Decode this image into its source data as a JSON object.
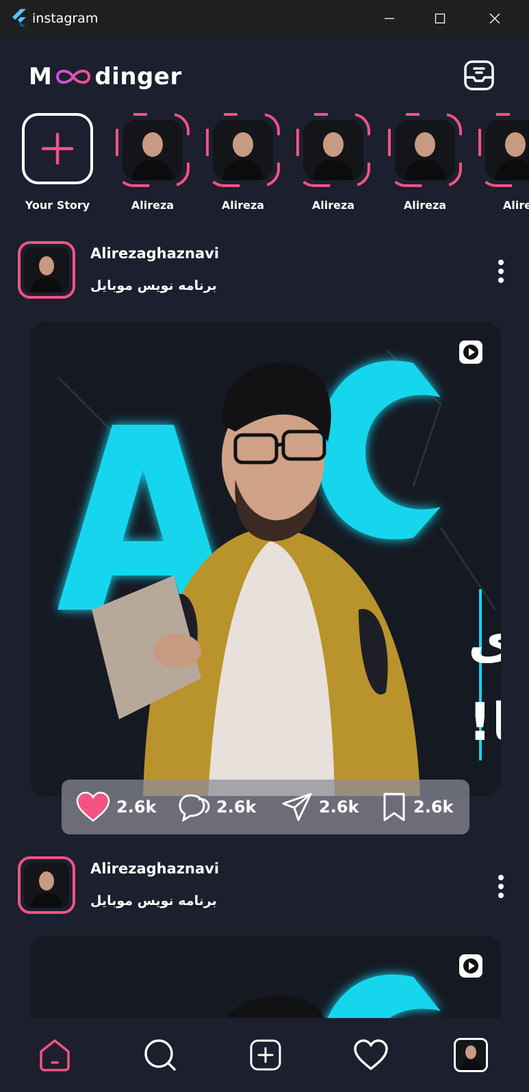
{
  "window": {
    "title": "instagram"
  },
  "brand": {
    "logo_pre": "M",
    "logo_post": "dinger"
  },
  "stories": {
    "your_story_label": "Your Story",
    "items": [
      {
        "label": "Alireza"
      },
      {
        "label": "Alireza"
      },
      {
        "label": "Alireza"
      },
      {
        "label": "Alireza"
      },
      {
        "label": "Alire"
      }
    ]
  },
  "posts": [
    {
      "username": "Alirezaghaznavi",
      "bio": "برنامه نویس موبایل",
      "image_text_line1": "انگلیسی برای",
      "image_text_line2": "برنامه نویس ها!",
      "likes": "2.6k",
      "comments": "2.6k",
      "shares": "2.6k",
      "saves": "2.6k"
    },
    {
      "username": "Alirezaghaznavi",
      "bio": "برنامه نویس موبایل"
    }
  ],
  "colors": {
    "accent": "#f35383",
    "bg": "#1c1f2e",
    "cyan": "#19d8f0"
  },
  "icons": {
    "nav": [
      "home-icon",
      "search-icon",
      "add-icon",
      "heart-icon",
      "profile-avatar"
    ]
  }
}
